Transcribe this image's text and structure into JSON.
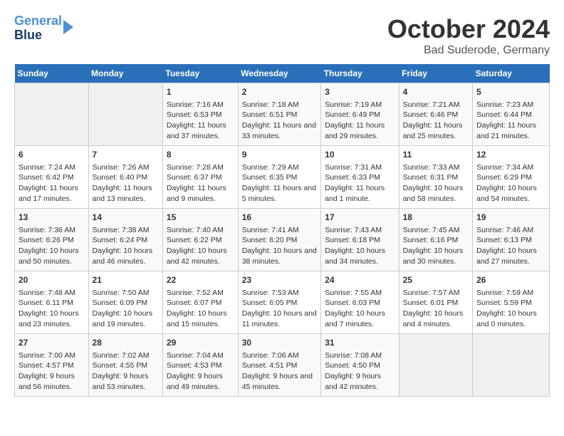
{
  "header": {
    "logo_line1": "General",
    "logo_line2": "Blue",
    "month": "October 2024",
    "location": "Bad Suderode, Germany"
  },
  "days_of_week": [
    "Sunday",
    "Monday",
    "Tuesday",
    "Wednesday",
    "Thursday",
    "Friday",
    "Saturday"
  ],
  "weeks": [
    [
      {
        "day": "",
        "info": ""
      },
      {
        "day": "",
        "info": ""
      },
      {
        "day": "1",
        "info": "Sunrise: 7:16 AM\nSunset: 6:53 PM\nDaylight: 11 hours and 37 minutes."
      },
      {
        "day": "2",
        "info": "Sunrise: 7:18 AM\nSunset: 6:51 PM\nDaylight: 11 hours and 33 minutes."
      },
      {
        "day": "3",
        "info": "Sunrise: 7:19 AM\nSunset: 6:49 PM\nDaylight: 11 hours and 29 minutes."
      },
      {
        "day": "4",
        "info": "Sunrise: 7:21 AM\nSunset: 6:46 PM\nDaylight: 11 hours and 25 minutes."
      },
      {
        "day": "5",
        "info": "Sunrise: 7:23 AM\nSunset: 6:44 PM\nDaylight: 11 hours and 21 minutes."
      }
    ],
    [
      {
        "day": "6",
        "info": "Sunrise: 7:24 AM\nSunset: 6:42 PM\nDaylight: 11 hours and 17 minutes."
      },
      {
        "day": "7",
        "info": "Sunrise: 7:26 AM\nSunset: 6:40 PM\nDaylight: 11 hours and 13 minutes."
      },
      {
        "day": "8",
        "info": "Sunrise: 7:28 AM\nSunset: 6:37 PM\nDaylight: 11 hours and 9 minutes."
      },
      {
        "day": "9",
        "info": "Sunrise: 7:29 AM\nSunset: 6:35 PM\nDaylight: 11 hours and 5 minutes."
      },
      {
        "day": "10",
        "info": "Sunrise: 7:31 AM\nSunset: 6:33 PM\nDaylight: 11 hours and 1 minute."
      },
      {
        "day": "11",
        "info": "Sunrise: 7:33 AM\nSunset: 6:31 PM\nDaylight: 10 hours and 58 minutes."
      },
      {
        "day": "12",
        "info": "Sunrise: 7:34 AM\nSunset: 6:29 PM\nDaylight: 10 hours and 54 minutes."
      }
    ],
    [
      {
        "day": "13",
        "info": "Sunrise: 7:36 AM\nSunset: 6:26 PM\nDaylight: 10 hours and 50 minutes."
      },
      {
        "day": "14",
        "info": "Sunrise: 7:38 AM\nSunset: 6:24 PM\nDaylight: 10 hours and 46 minutes."
      },
      {
        "day": "15",
        "info": "Sunrise: 7:40 AM\nSunset: 6:22 PM\nDaylight: 10 hours and 42 minutes."
      },
      {
        "day": "16",
        "info": "Sunrise: 7:41 AM\nSunset: 6:20 PM\nDaylight: 10 hours and 38 minutes."
      },
      {
        "day": "17",
        "info": "Sunrise: 7:43 AM\nSunset: 6:18 PM\nDaylight: 10 hours and 34 minutes."
      },
      {
        "day": "18",
        "info": "Sunrise: 7:45 AM\nSunset: 6:16 PM\nDaylight: 10 hours and 30 minutes."
      },
      {
        "day": "19",
        "info": "Sunrise: 7:46 AM\nSunset: 6:13 PM\nDaylight: 10 hours and 27 minutes."
      }
    ],
    [
      {
        "day": "20",
        "info": "Sunrise: 7:48 AM\nSunset: 6:11 PM\nDaylight: 10 hours and 23 minutes."
      },
      {
        "day": "21",
        "info": "Sunrise: 7:50 AM\nSunset: 6:09 PM\nDaylight: 10 hours and 19 minutes."
      },
      {
        "day": "22",
        "info": "Sunrise: 7:52 AM\nSunset: 6:07 PM\nDaylight: 10 hours and 15 minutes."
      },
      {
        "day": "23",
        "info": "Sunrise: 7:53 AM\nSunset: 6:05 PM\nDaylight: 10 hours and 11 minutes."
      },
      {
        "day": "24",
        "info": "Sunrise: 7:55 AM\nSunset: 6:03 PM\nDaylight: 10 hours and 7 minutes."
      },
      {
        "day": "25",
        "info": "Sunrise: 7:57 AM\nSunset: 6:01 PM\nDaylight: 10 hours and 4 minutes."
      },
      {
        "day": "26",
        "info": "Sunrise: 7:59 AM\nSunset: 5:59 PM\nDaylight: 10 hours and 0 minutes."
      }
    ],
    [
      {
        "day": "27",
        "info": "Sunrise: 7:00 AM\nSunset: 4:57 PM\nDaylight: 9 hours and 56 minutes."
      },
      {
        "day": "28",
        "info": "Sunrise: 7:02 AM\nSunset: 4:55 PM\nDaylight: 9 hours and 53 minutes."
      },
      {
        "day": "29",
        "info": "Sunrise: 7:04 AM\nSunset: 4:53 PM\nDaylight: 9 hours and 49 minutes."
      },
      {
        "day": "30",
        "info": "Sunrise: 7:06 AM\nSunset: 4:51 PM\nDaylight: 9 hours and 45 minutes."
      },
      {
        "day": "31",
        "info": "Sunrise: 7:08 AM\nSunset: 4:50 PM\nDaylight: 9 hours and 42 minutes."
      },
      {
        "day": "",
        "info": ""
      },
      {
        "day": "",
        "info": ""
      }
    ]
  ]
}
